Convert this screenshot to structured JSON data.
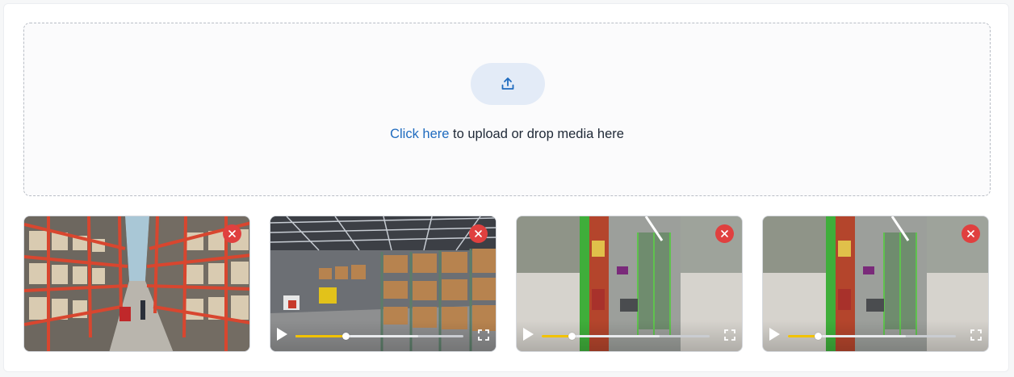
{
  "uploader": {
    "link_text": "Click here",
    "rest_text": " to upload or drop media here",
    "upload_icon": "upload-icon"
  },
  "colors": {
    "accent": "#1f6bbf",
    "remove": "#e0403f",
    "progress": "#f2c200"
  },
  "media": [
    {
      "kind": "image",
      "scene": "warehouse-aisle"
    },
    {
      "kind": "video",
      "scene": "warehouse-interior",
      "progress": 0.3
    },
    {
      "kind": "video",
      "scene": "store-aisle",
      "progress": 0.18
    },
    {
      "kind": "video",
      "scene": "store-aisle",
      "progress": 0.18
    }
  ]
}
